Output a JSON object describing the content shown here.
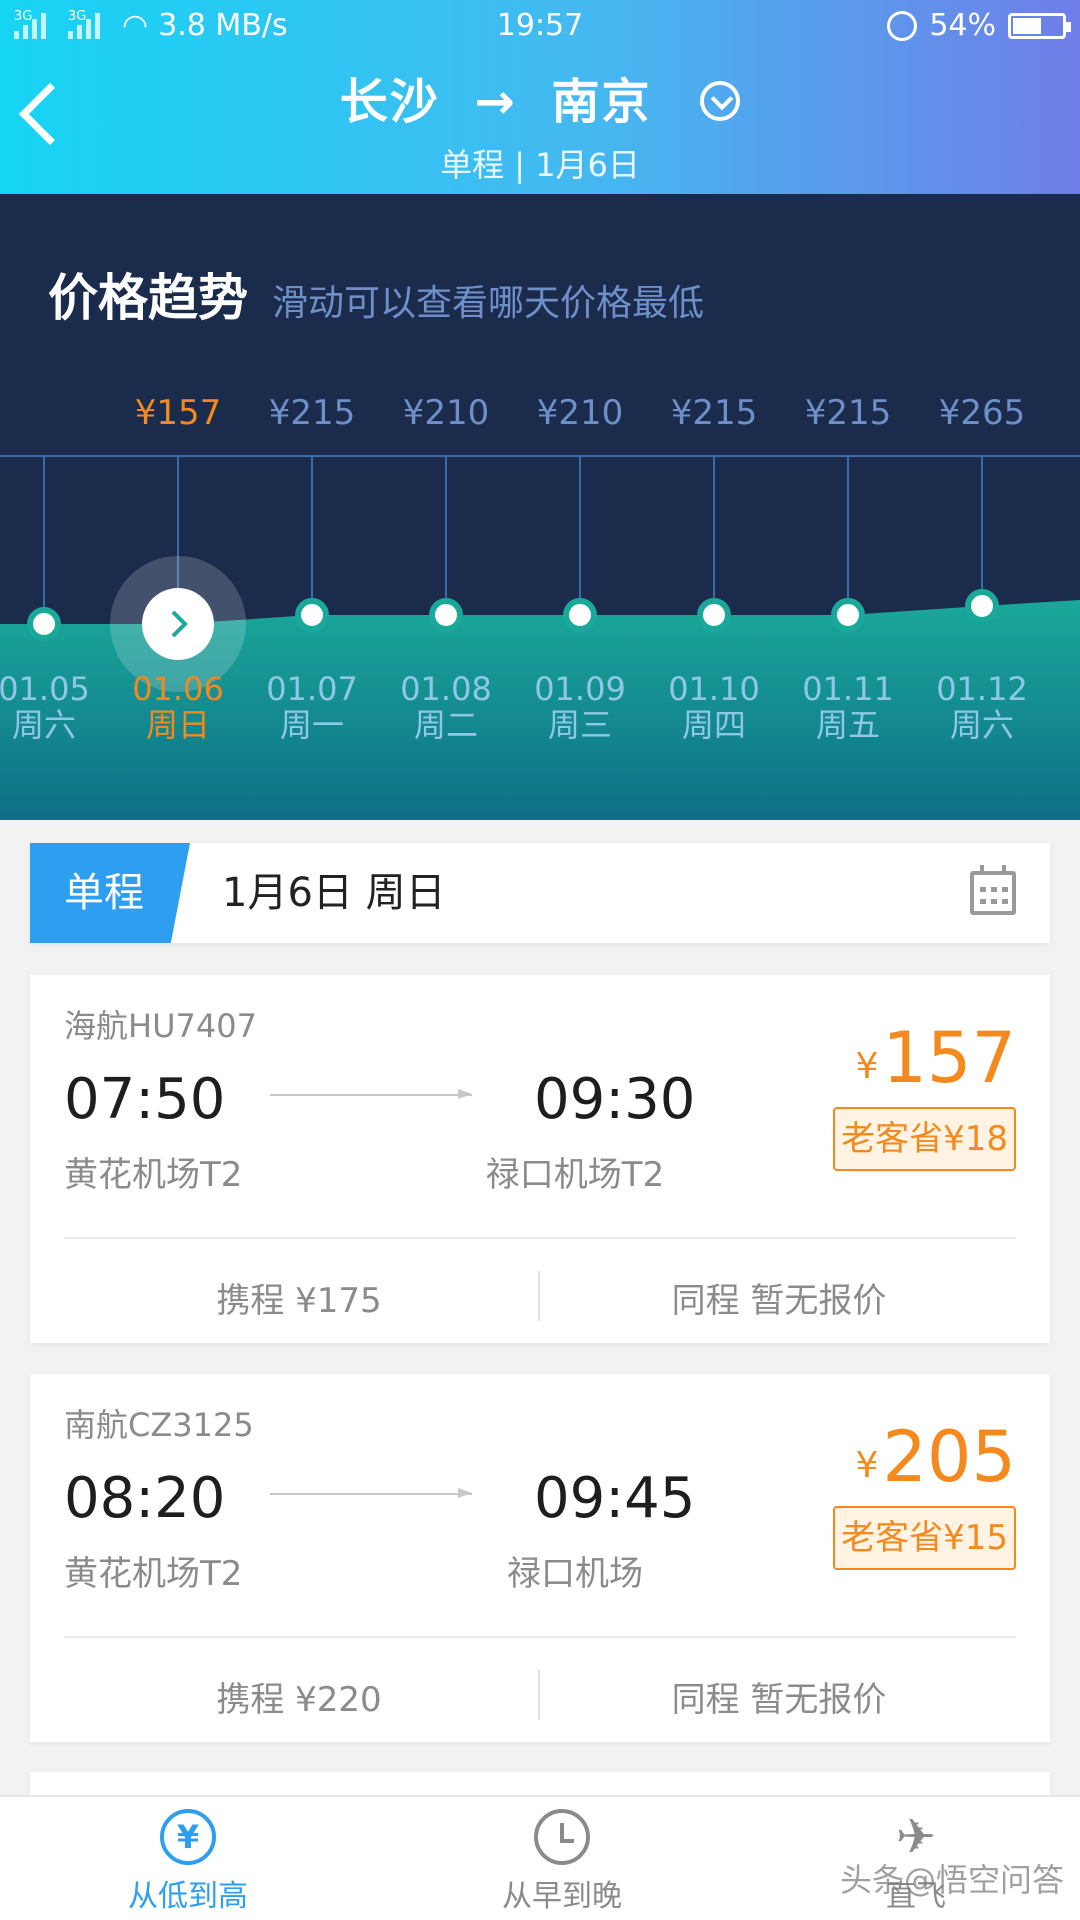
{
  "status_bar": {
    "signal1": "3G",
    "signal2": "3G",
    "speed": "3.8 MB/s",
    "time": "19:57",
    "battery": "54%"
  },
  "header": {
    "route_from": "长沙",
    "route_arrow": "→",
    "route_to": "南京",
    "subtitle": "单程 | 1月6日"
  },
  "trend": {
    "title": "价格趋势",
    "hint": "滑动可以查看哪天价格最低",
    "selected_index": 1,
    "days": [
      {
        "price": "",
        "date": "01.05",
        "weekday": "周六",
        "level": 0
      },
      {
        "price": "¥157",
        "date": "01.06",
        "weekday": "周日",
        "level": 0
      },
      {
        "price": "¥215",
        "date": "01.07",
        "weekday": "周一",
        "level": 1
      },
      {
        "price": "¥210",
        "date": "01.08",
        "weekday": "周二",
        "level": 1
      },
      {
        "price": "¥210",
        "date": "01.09",
        "weekday": "周三",
        "level": 1
      },
      {
        "price": "¥215",
        "date": "01.10",
        "weekday": "周四",
        "level": 1
      },
      {
        "price": "¥215",
        "date": "01.11",
        "weekday": "周五",
        "level": 1
      },
      {
        "price": "¥265",
        "date": "01.12",
        "weekday": "周六",
        "level": 2
      }
    ],
    "colors": {
      "accent": "#f48a1e",
      "price": "#6f8fc9",
      "wave": "#1aa89a"
    }
  },
  "date_bar": {
    "tag": "单程",
    "date": "1月6日 周日"
  },
  "flights": [
    {
      "airline": "海航HU7407",
      "dep_time": "07:50",
      "dep_airport": "黄花机场T2",
      "arr_time": "09:30",
      "arr_airport": "禄口机场T2",
      "price_symbol": "¥",
      "price": "157",
      "badge": "老客省¥18",
      "ota1": "携程 ¥175",
      "ota2": "同程 暂无报价"
    },
    {
      "airline": "南航CZ3125",
      "dep_time": "08:20",
      "dep_airport": "黄花机场T2",
      "arr_time": "09:45",
      "arr_airport": "禄口机场",
      "price_symbol": "¥",
      "price": "205",
      "badge": "老客省¥15",
      "ota1": "携程 ¥220",
      "ota2": "同程 暂无报价"
    }
  ],
  "bottom_tabs": [
    {
      "label": "从低到高",
      "icon": "yen-icon",
      "symbol": "¥",
      "active": true
    },
    {
      "label": "从早到晚",
      "icon": "clock-icon",
      "symbol": "",
      "active": false
    },
    {
      "label": "直飞",
      "icon": "plane-icon",
      "symbol": "✈",
      "active": false
    }
  ],
  "watermark": "头条@悟空问答"
}
